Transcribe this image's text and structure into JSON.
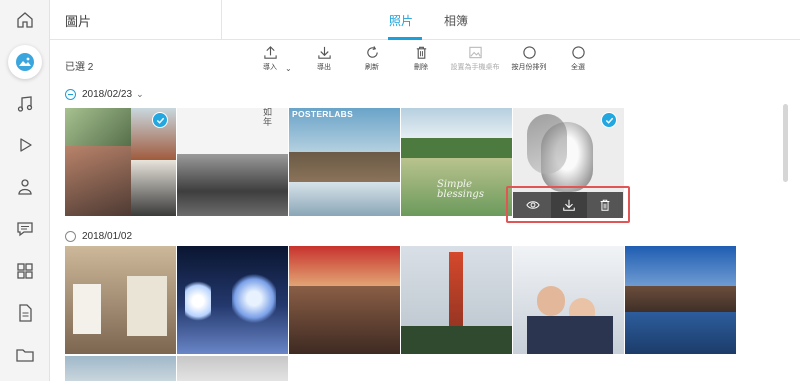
{
  "header": {
    "title": "圖片",
    "tabs": [
      {
        "label": "照片",
        "active": true
      },
      {
        "label": "相簿",
        "active": false
      }
    ]
  },
  "sidebar": {
    "items": [
      {
        "icon": "home-icon",
        "active": false
      },
      {
        "icon": "photos-icon",
        "active": true
      },
      {
        "icon": "music-icon",
        "active": false
      },
      {
        "icon": "video-play-icon",
        "active": false
      },
      {
        "icon": "contacts-icon",
        "active": false
      },
      {
        "icon": "messages-icon",
        "active": false
      },
      {
        "icon": "apps-grid-icon",
        "active": false
      },
      {
        "icon": "document-icon",
        "active": false
      },
      {
        "icon": "folder-icon",
        "active": false
      }
    ]
  },
  "toolbar": {
    "selected_count": "已選 2",
    "tools": [
      {
        "label": "導入",
        "icon": "upload-icon",
        "enabled": true,
        "has_menu": true
      },
      {
        "label": "導出",
        "icon": "download-icon",
        "enabled": true
      },
      {
        "label": "刷新",
        "icon": "refresh-icon",
        "enabled": true
      },
      {
        "label": "刪除",
        "icon": "trash-icon",
        "enabled": true
      },
      {
        "label": "設置為手機桌布",
        "icon": "wallpaper-icon",
        "enabled": false
      },
      {
        "label": "按月份排列",
        "icon": "circle-icon",
        "enabled": true
      },
      {
        "label": "全選",
        "icon": "circle-icon",
        "enabled": true
      }
    ]
  },
  "groups": [
    {
      "date": "2018/02/23",
      "selection": "partial",
      "expandable": true
    },
    {
      "date": "2018/01/02",
      "selection": "none",
      "expandable": false
    }
  ],
  "photos": {
    "group1": [
      {
        "title": "collage-travel-magazine",
        "selected": true
      },
      {
        "title": "bw-warehouse-calligraphy",
        "selected": false,
        "text": "如\n年"
      },
      {
        "title": "posterlabs-canal-warehouses",
        "selected": false,
        "text": "POSTERLABS"
      },
      {
        "title": "simple-blessings-lake",
        "selected": false,
        "text": "Simple\nblessings"
      },
      {
        "title": "sketch-portrait",
        "selected": true,
        "hovered": true
      }
    ],
    "group2": [
      {
        "title": "cuckoo-clocks"
      },
      {
        "title": "night-illumination-trees"
      },
      {
        "title": "shopping-arcade"
      },
      {
        "title": "tv-tower-day"
      },
      {
        "title": "selfie-tv-tower-snow"
      },
      {
        "title": "canal-warehouses-winter"
      }
    ]
  },
  "hover_actions": [
    {
      "icon": "eye-icon",
      "label": "preview"
    },
    {
      "icon": "download-icon",
      "label": "export"
    },
    {
      "icon": "trash-icon",
      "label": "delete"
    }
  ],
  "colors": {
    "accent": "#1aa1dc",
    "highlight_border": "#e05656",
    "action_bar": "#555555"
  }
}
